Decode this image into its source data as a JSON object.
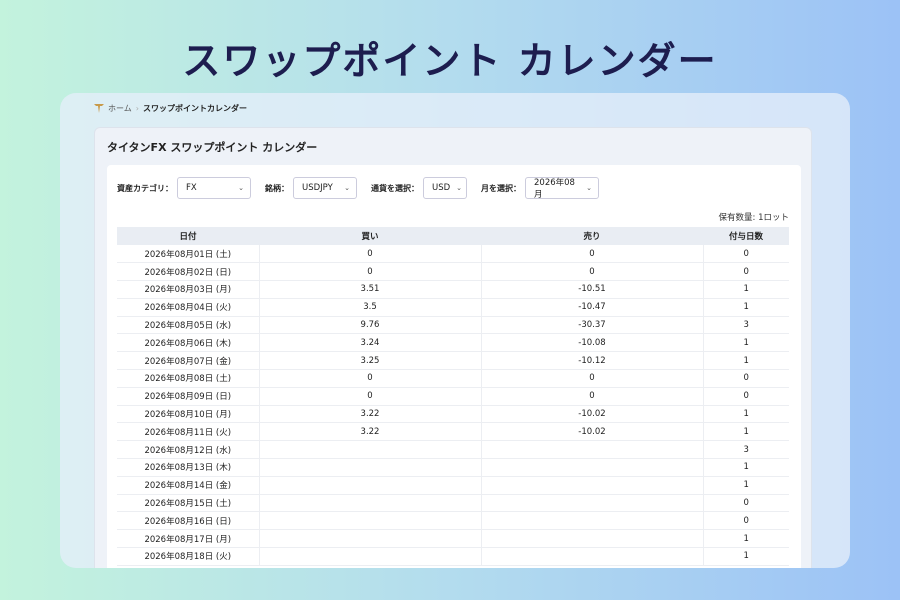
{
  "hero_title": "スワップポイント カレンダー",
  "breadcrumb": {
    "home": "ホーム",
    "separator": "›",
    "current": "スワップポイントカレンダー"
  },
  "card_title": "タイタンFX スワップポイント カレンダー",
  "filters": {
    "asset_label": "資産カテゴリ：",
    "asset_value": "FX",
    "symbol_label": "銘柄：",
    "symbol_value": "USDJPY",
    "currency_label": "通貨を選択：",
    "currency_value": "USD",
    "month_label": "月を選択：",
    "month_value": "2026年08月"
  },
  "holding": "保有数量: 1ロット",
  "table": {
    "headers": [
      "日付",
      "買い",
      "売り",
      "付与日数"
    ],
    "rows": [
      [
        "2026年08月01日 (土)",
        "0",
        "0",
        "0"
      ],
      [
        "2026年08月02日 (日)",
        "0",
        "0",
        "0"
      ],
      [
        "2026年08月03日 (月)",
        "3.51",
        "-10.51",
        "1"
      ],
      [
        "2026年08月04日 (火)",
        "3.5",
        "-10.47",
        "1"
      ],
      [
        "2026年08月05日 (水)",
        "9.76",
        "-30.37",
        "3"
      ],
      [
        "2026年08月06日 (木)",
        "3.24",
        "-10.08",
        "1"
      ],
      [
        "2026年08月07日 (金)",
        "3.25",
        "-10.12",
        "1"
      ],
      [
        "2026年08月08日 (土)",
        "0",
        "0",
        "0"
      ],
      [
        "2026年08月09日 (日)",
        "0",
        "0",
        "0"
      ],
      [
        "2026年08月10日 (月)",
        "3.22",
        "-10.02",
        "1"
      ],
      [
        "2026年08月11日 (火)",
        "3.22",
        "-10.02",
        "1"
      ],
      [
        "2026年08月12日 (水)",
        "",
        "",
        "3"
      ],
      [
        "2026年08月13日 (木)",
        "",
        "",
        "1"
      ],
      [
        "2026年08月14日 (金)",
        "",
        "",
        "1"
      ],
      [
        "2026年08月15日 (土)",
        "",
        "",
        "0"
      ],
      [
        "2026年08月16日 (日)",
        "",
        "",
        "0"
      ],
      [
        "2026年08月17日 (月)",
        "",
        "",
        "1"
      ],
      [
        "2026年08月18日 (火)",
        "",
        "",
        "1"
      ]
    ]
  }
}
